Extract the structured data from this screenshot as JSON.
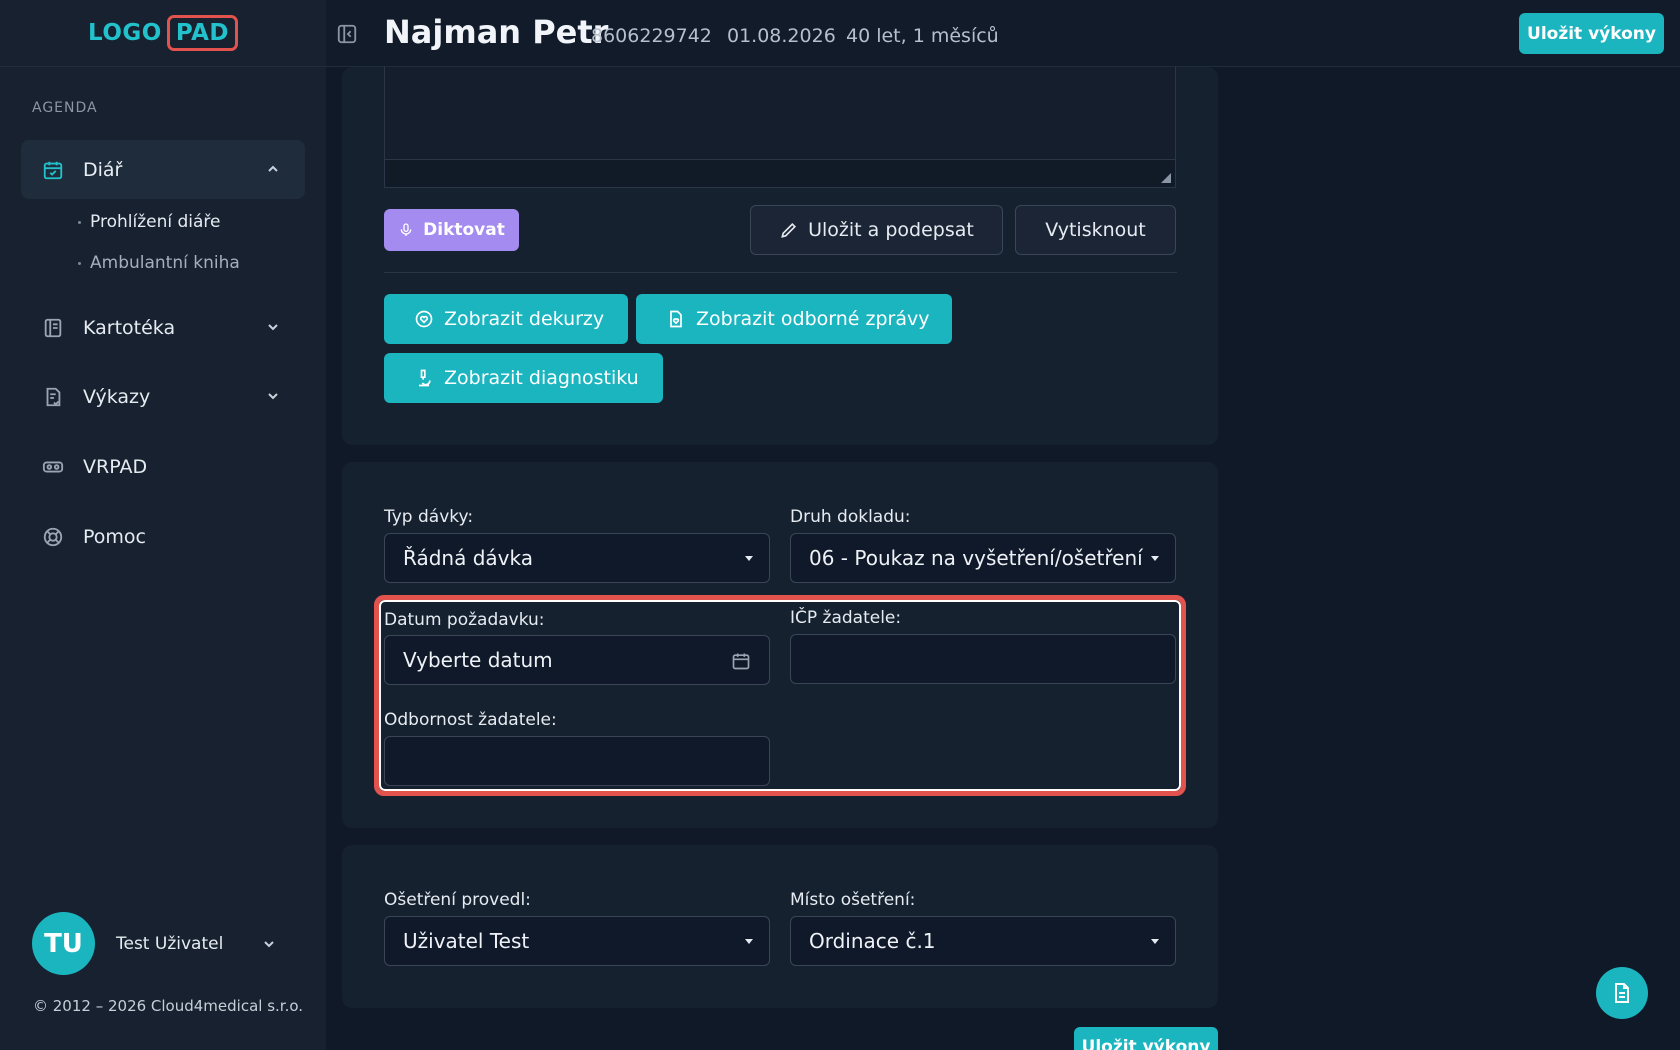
{
  "logo": {
    "part1": "LOGO",
    "part2": "PAD"
  },
  "sidebar": {
    "section_title": "AGENDA",
    "items": [
      {
        "label": "Diář"
      },
      {
        "label": "Kartotéka"
      },
      {
        "label": "Výkazy"
      },
      {
        "label": "VRPAD"
      },
      {
        "label": "Pomoc"
      }
    ],
    "sub_items": [
      {
        "label": "Prohlížení diáře"
      },
      {
        "label": "Ambulantní kniha"
      }
    ]
  },
  "user": {
    "initials": "TU",
    "name": "Test Uživatel"
  },
  "copyright": "© 2012 – 2026 Cloud4medical s.r.o.",
  "header": {
    "patient_name": "Najman Petr",
    "patient_id": "8606229742",
    "date": "01.08.2026",
    "age": "40 let, 1 měsíců",
    "save_button": "Uložit výkony"
  },
  "record": {
    "dictate_button": "Diktovat",
    "save_sign_button": "Uložit a podepsat",
    "print_button": "Vytisknout",
    "show_decursus_button": "Zobrazit dekurzy",
    "show_reports_button": "Zobrazit odborné zprávy",
    "show_diagnostics_button": "Zobrazit diagnostiku"
  },
  "batch": {
    "batch_type_label": "Typ dávky:",
    "batch_type_value": "Řádná dávka",
    "document_type_label": "Druh dokladu:",
    "document_type_value": "06 - Poukaz na vyšetření/ošetření",
    "request_date_label": "Datum požadavku:",
    "request_date_placeholder": "Vyberte datum",
    "requester_icp_label": "IČP žadatele:",
    "requester_icp_value": "",
    "requester_specialty_label": "Odbornost žadatele:",
    "requester_specialty_value": ""
  },
  "treatment": {
    "performed_by_label": "Ošetření provedl:",
    "performed_by_value": "Uživatel Test",
    "place_label": "Místo ošetření:",
    "place_value": "Ordinace č.1"
  },
  "footer": {
    "save_button": "Uložit výkony"
  },
  "colors": {
    "accent": "#1bb5c0",
    "highlight": "#e2534d",
    "dictate": "#a48bf0",
    "background": "#0f1928"
  }
}
